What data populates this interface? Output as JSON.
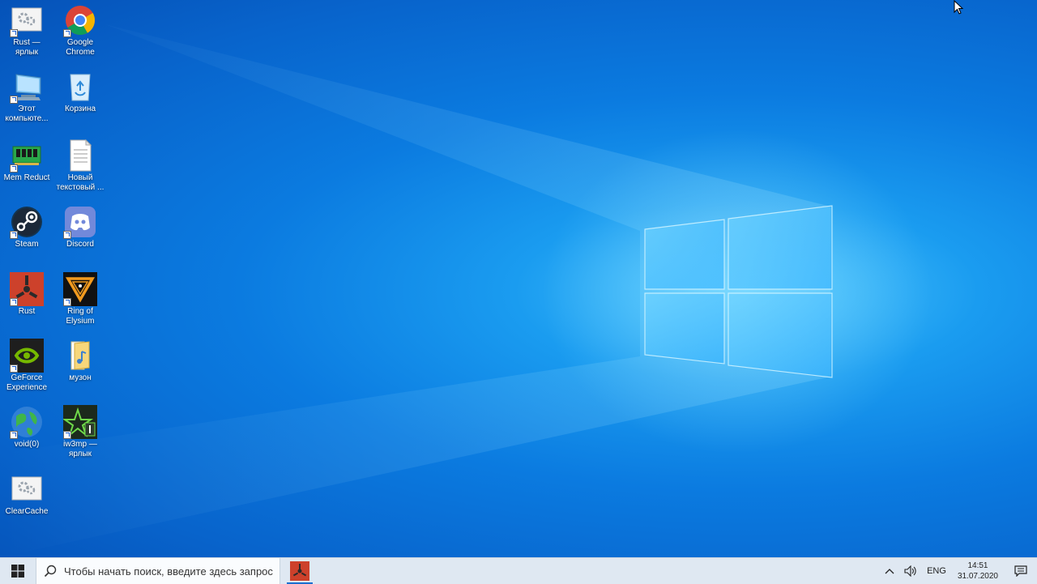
{
  "desktop": {
    "icons": [
      {
        "label": "Rust —\nярлык",
        "icon": "gear-shortcut-icon"
      },
      {
        "label": "Google\nChrome",
        "icon": "chrome-icon"
      },
      {
        "label": "Этот\nкомпьюте...",
        "icon": "computer-icon"
      },
      {
        "label": "Корзина",
        "icon": "recycle-bin-icon"
      },
      {
        "label": "Mem Reduct",
        "icon": "memory-chip-icon"
      },
      {
        "label": "Новый\nтекстовый ...",
        "icon": "text-document-icon"
      },
      {
        "label": "Steam",
        "icon": "steam-icon"
      },
      {
        "label": "Discord",
        "icon": "discord-icon"
      },
      {
        "label": "Rust",
        "icon": "rust-icon"
      },
      {
        "label": "Ring of\nElysium",
        "icon": "ring-of-elysium-icon"
      },
      {
        "label": "GeForce\nExperience",
        "icon": "nvidia-icon"
      },
      {
        "label": "музон",
        "icon": "music-folder-icon"
      },
      {
        "label": "void(0)",
        "icon": "globe-icon"
      },
      {
        "label": "iw3mp —\nярлык",
        "icon": "cod4-icon"
      },
      {
        "label": "ClearCache",
        "icon": "gear-app-icon"
      }
    ]
  },
  "taskbar": {
    "search_placeholder": "Чтобы начать поиск, введите здесь запрос",
    "pinned_app": "rust-icon",
    "tray": {
      "language": "ENG",
      "time": "14:51",
      "date": "31.07.2020"
    }
  },
  "colors": {
    "accent": "#0a78e0",
    "taskbar": "#dfe8f2"
  }
}
